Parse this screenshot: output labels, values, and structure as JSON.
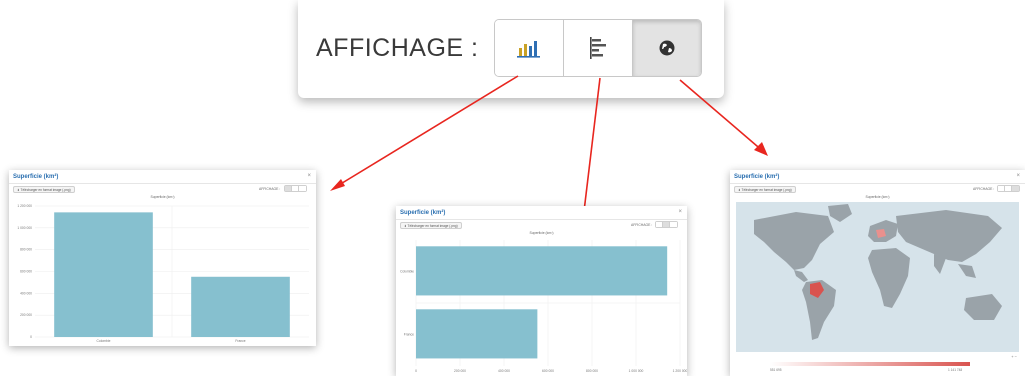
{
  "toolbar": {
    "label": "AFFICHAGE :",
    "buttons": [
      {
        "icon": "bar-chart-icon",
        "active": false
      },
      {
        "icon": "horizontal-bar-chart-icon",
        "active": false
      },
      {
        "icon": "globe-icon",
        "active": true
      }
    ]
  },
  "panels": {
    "title": "Superficie (km²)",
    "close": "×",
    "download": "⬇ Télécharger en format image (.png)",
    "affichage": "AFFICHAGE :",
    "subtitle": "Superficie (km²)"
  },
  "chart_data": [
    {
      "type": "bar",
      "title": "Superficie (km²)",
      "categories": [
        "Colombie",
        "France"
      ],
      "values": [
        1141748,
        551695
      ],
      "ylim": [
        0,
        1200000
      ],
      "yticks": [
        "1 200 000",
        "1 000 000",
        "800 000",
        "600 000",
        "400 000",
        "200 000",
        "0"
      ]
    },
    {
      "type": "bar",
      "orientation": "horizontal",
      "title": "Superficie (km²)",
      "categories": [
        "Colombie",
        "France"
      ],
      "values": [
        1141748,
        551695
      ],
      "xlim": [
        0,
        1200000
      ],
      "xticks": [
        "0",
        "200 000",
        "400 000",
        "600 000",
        "800 000",
        "1 000 000",
        "1 200 000"
      ]
    },
    {
      "type": "map",
      "title": "Superficie (km²)",
      "highlighted": [
        "Colombie",
        "France"
      ],
      "scale_min": "551 695",
      "scale_max": "1 141 748",
      "colors": {
        "land": "#9aa3a9",
        "ocean": "#d6e3ea",
        "high": "#d9534f",
        "low": "#f2c2c0"
      }
    }
  ],
  "colors": {
    "bar": "#86c0cf",
    "arrow": "#e8261f",
    "title": "#2a6fb0"
  }
}
